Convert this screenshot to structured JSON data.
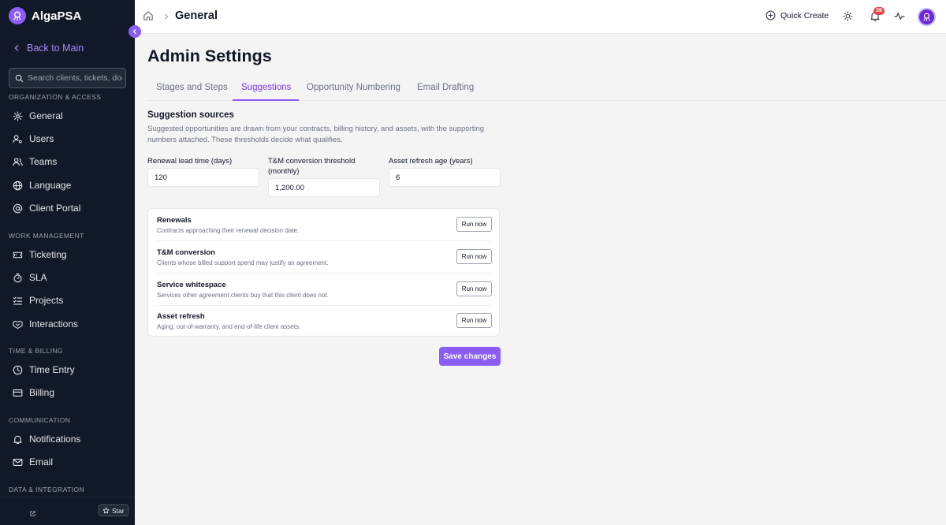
{
  "app": {
    "name": "AlgaPSA"
  },
  "sidebar": {
    "back_label": "Back to Main",
    "search_placeholder": "Search clients, tickets, doc",
    "sections": [
      {
        "heading": "ORGANIZATION & ACCESS",
        "items": [
          {
            "label": "General",
            "icon": "gear-icon"
          },
          {
            "label": "Users",
            "icon": "user-key-icon"
          },
          {
            "label": "Teams",
            "icon": "users-icon"
          },
          {
            "label": "Language",
            "icon": "globe-icon"
          },
          {
            "label": "Client Portal",
            "icon": "at-icon"
          }
        ]
      },
      {
        "heading": "WORK MANAGEMENT",
        "items": [
          {
            "label": "Ticketing",
            "icon": "ticket-icon"
          },
          {
            "label": "SLA",
            "icon": "timer-icon"
          },
          {
            "label": "Projects",
            "icon": "list-checks-icon"
          },
          {
            "label": "Interactions",
            "icon": "handshake-icon"
          }
        ]
      },
      {
        "heading": "TIME & BILLING",
        "items": [
          {
            "label": "Time Entry",
            "icon": "clock-icon"
          },
          {
            "label": "Billing",
            "icon": "credit-card-icon"
          }
        ]
      },
      {
        "heading": "COMMUNICATION",
        "items": [
          {
            "label": "Notifications",
            "icon": "bell-icon"
          },
          {
            "label": "Email",
            "icon": "mail-icon"
          }
        ]
      },
      {
        "heading": "DATA & INTEGRATION",
        "items": []
      }
    ],
    "star_label": "Star"
  },
  "header": {
    "breadcrumb_title": "General",
    "quick_create_label": "Quick Create",
    "notification_count": "39"
  },
  "main": {
    "page_title": "Admin Settings",
    "tabs": [
      {
        "label": "Stages and Steps",
        "active": false
      },
      {
        "label": "Suggestions",
        "active": true
      },
      {
        "label": "Opportunity Numbering",
        "active": false
      },
      {
        "label": "Email Drafting",
        "active": false
      }
    ],
    "section_title": "Suggestion sources",
    "section_description": "Suggested opportunities are drawn from your contracts, billing history, and assets, with the supporting numbers attached. These thresholds decide what qualifies.",
    "fields": [
      {
        "label": "Renewal lead time (days)",
        "value": "120"
      },
      {
        "label": "T&M conversion threshold (monthly)",
        "value": "1,200.00"
      },
      {
        "label": "Asset refresh age (years)",
        "value": "6"
      }
    ],
    "sources": [
      {
        "title": "Renewals",
        "description": "Contracts approaching their renewal decision date.",
        "button": "Run now"
      },
      {
        "title": "T&M conversion",
        "description": "Clients whose billed support spend may justify an agreement.",
        "button": "Run now"
      },
      {
        "title": "Service whitespace",
        "description": "Services other agreement clients buy that this client does not.",
        "button": "Run now"
      },
      {
        "title": "Asset refresh",
        "description": "Aging, out-of-warranty, and end-of-life client assets.",
        "button": "Run now"
      }
    ],
    "save_label": "Save changes"
  },
  "colors": {
    "accent": "#8b5cf6",
    "sidebar_bg": "#111827",
    "badge": "#ef4444"
  }
}
